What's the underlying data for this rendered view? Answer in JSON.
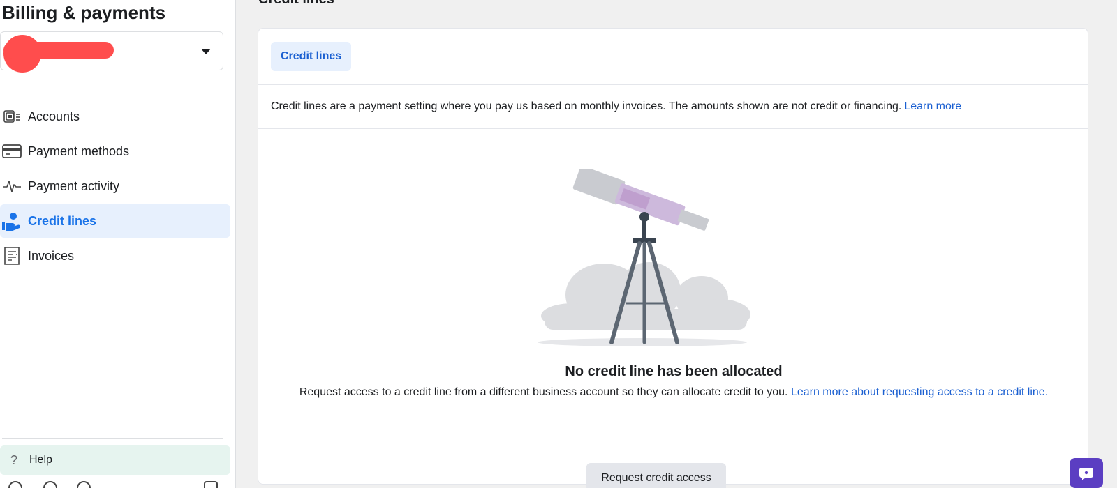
{
  "sidebar": {
    "title": "Billing & payments",
    "account_selector": {
      "value": ""
    },
    "items": [
      {
        "label": "Accounts",
        "icon": "accounts-icon",
        "active": false
      },
      {
        "label": "Payment methods",
        "icon": "credit-card-icon",
        "active": false
      },
      {
        "label": "Payment activity",
        "icon": "activity-pulse-icon",
        "active": false
      },
      {
        "label": "Credit lines",
        "icon": "credit-line-hand-icon",
        "active": true
      },
      {
        "label": "Invoices",
        "icon": "invoice-icon",
        "active": false
      }
    ],
    "help_label": "Help"
  },
  "main": {
    "page_title": "Credit lines",
    "tab_label": "Credit lines",
    "info_text": "Credit lines are a payment setting where you pay us based on monthly invoices. The amounts shown are not credit or financing.",
    "info_link": "Learn more",
    "empty_state": {
      "title": "No credit line has been allocated",
      "description": "Request access to a credit line from a different business account so they can allocate credit to you.",
      "link": "Learn more about requesting access to a credit line.",
      "button_label": "Request credit access"
    }
  },
  "colors": {
    "accent": "#1a73e8",
    "active_bg": "#e7f0fd",
    "help_bg": "#e6f4ef",
    "chat_button": "#5b3ec2",
    "redaction": "#ff4d4d"
  }
}
